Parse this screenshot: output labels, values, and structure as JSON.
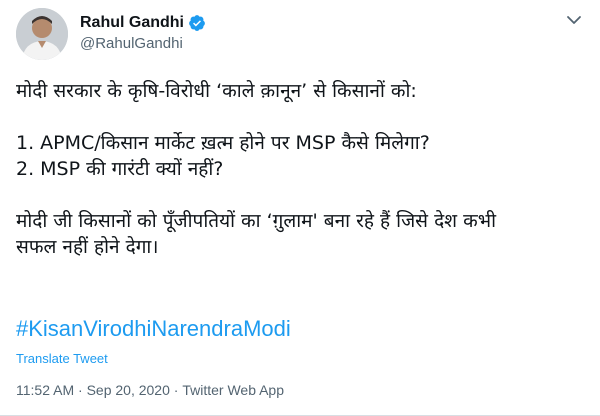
{
  "author": {
    "display_name": "Rahul Gandhi",
    "handle": "@RahulGandhi"
  },
  "tweet": {
    "lines": [
      "मोदी सरकार के कृषि-विरोधी ‘काले क़ानून’ से किसानों को:",
      "",
      "1. APMC/किसान मार्केट ख़त्म होने पर MSP कैसे मिलेगा?",
      "2. MSP की गारंटी क्यों नहीं?",
      "",
      "मोदी जी किसानों को पूँजीपतियों का ‘ग़ुलाम' बना रहे हैं जिसे देश कभी",
      "सफल नहीं होने देगा।"
    ],
    "hashtag": "#KisanVirodhiNarendraModi",
    "translate_label": "Translate Tweet",
    "time": "11:52 AM",
    "separator": "·",
    "date": "Sep 20, 2020",
    "source": "Twitter Web App"
  },
  "colors": {
    "link": "#1d9bf0",
    "meta": "#536471",
    "verified": "#1d9bf0"
  },
  "icons": {
    "verified": "verified-badge-icon",
    "menu": "chevron-down-icon"
  }
}
